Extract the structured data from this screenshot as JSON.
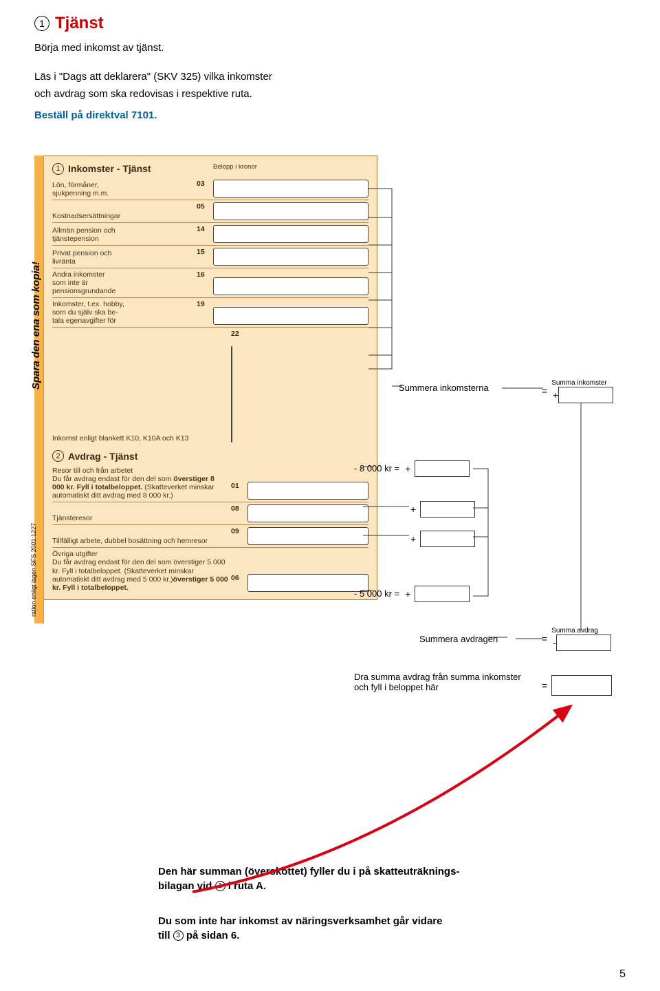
{
  "header": {
    "num": "1",
    "title": "Tjänst",
    "intro1": "Börja med inkomst av tjänst.",
    "intro2a": "Läs i \"Dags att deklarera\" (SKV 325) vilka inkomster",
    "intro2b": "och avdrag som ska redovisas i respektive ruta.",
    "link": "Beställ på direktval 7101."
  },
  "side": {
    "spara": "Spara den ena som kopia!",
    "ration": "ration enligt lagen SFS 2001:1227"
  },
  "section1": {
    "num": "1",
    "title": "Inkomster - Tjänst",
    "belopp": "Belopp i kronor",
    "rows": [
      {
        "label": "Lön, förmåner,\nsjukpenning m.m.",
        "code": "03"
      },
      {
        "label": "Kostnadsersättningar",
        "code": "05"
      },
      {
        "label": "Allmän pension och\ntjänstepension",
        "code": "14"
      },
      {
        "label": "Privat pension och\nlivränta",
        "code": "15"
      },
      {
        "label": "Andra inkomster\nsom inte är\npensionsgrundande",
        "code": "16"
      },
      {
        "label": "Inkomster, t.ex. hobby,\nsom du själv ska be-\ntala egenavgifter för",
        "code": "19"
      },
      {
        "label": "Inkomst enligt blankett K10, K10A och K13",
        "code": "22",
        "wide": true
      }
    ]
  },
  "section2": {
    "num": "2",
    "title": "Avdrag - Tjänst",
    "rows": [
      {
        "label": "Resor till och från arbetet\nDu får avdrag endast för den del som överstiger 8 000 kr. Fyll i totalbeloppet. (Skatteverket minskar automatiskt ditt avdrag med 8 000 kr.)",
        "bold_part": "överstiger 8 000 kr. Fyll i totalbeloppet.",
        "code": "01"
      },
      {
        "label": "Tjänsteresor",
        "code": "08"
      },
      {
        "label": "Tillfälligt arbete, dubbel bosättning och hemresor",
        "code": "09"
      },
      {
        "label": "Övriga utgifter\nDu får avdrag endast för den del som överstiger 5 000 kr. Fyll i totalbeloppet. (Skatteverket minskar automatiskt ditt avdrag med 5 000 kr.)",
        "bold_part": "överstiger 5 000 kr.  Fyll i totalbeloppet.",
        "code": "06"
      }
    ]
  },
  "calc": {
    "sum_ink": "Summera inkomsterna",
    "sum_ink_box": "Summa inkomster",
    "m8000": "- 8 000 kr =",
    "m5000": "- 5 000 kr =",
    "sum_avd": "Summera avdragen",
    "sum_avd_box": "Summa avdrag",
    "dra1": "Dra summa avdrag från summa inkomster",
    "dra2": "och fyll i beloppet här"
  },
  "bottom": {
    "p1a": "Den här summan (överskottet) fyller du i på skatteuträknings-",
    "p1b": "bilagan vid ",
    "p1c": " i ruta A.",
    "n1": "1",
    "p2a": "Du som inte har inkomst av näringsverksamhet går vidare",
    "p2b": "till ",
    "p2c": " på sidan 6.",
    "n3": "3"
  },
  "pagenum": "5"
}
